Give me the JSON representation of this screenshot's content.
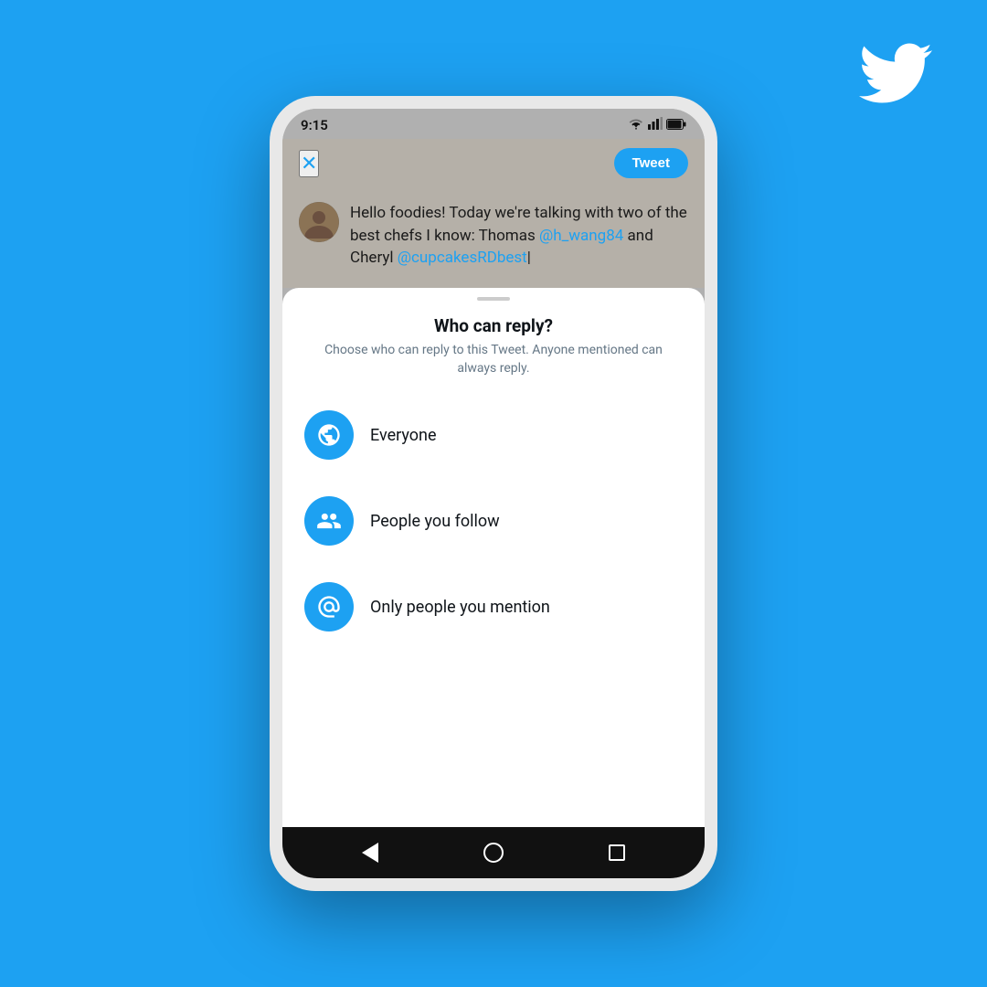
{
  "background_color": "#1DA1F2",
  "twitter_bird": "🐦",
  "phone": {
    "status_bar": {
      "time": "9:15",
      "icons": [
        "wifi",
        "signal",
        "battery"
      ]
    },
    "top_bar": {
      "close_label": "✕",
      "tweet_button_label": "Tweet"
    },
    "tweet": {
      "text_before": "Hello foodies! Today we're talking with two of the best chefs I know: Thomas ",
      "mention1": "@h_wang84",
      "text_middle": " and Cheryl ",
      "mention2": "@cupcakesRDbest",
      "cursor": "|"
    },
    "bottom_sheet": {
      "handle": true,
      "title": "Who can reply?",
      "subtitle": "Choose who can reply to this Tweet. Anyone mentioned can always reply.",
      "options": [
        {
          "id": "everyone",
          "icon": "🌐",
          "label": "Everyone"
        },
        {
          "id": "people-you-follow",
          "icon": "👥",
          "label": "People you follow"
        },
        {
          "id": "only-mention",
          "icon": "@",
          "label": "Only people you mention"
        }
      ]
    },
    "nav_bar": {
      "back_label": "◀",
      "home_label": "○",
      "recents_label": "□"
    }
  }
}
